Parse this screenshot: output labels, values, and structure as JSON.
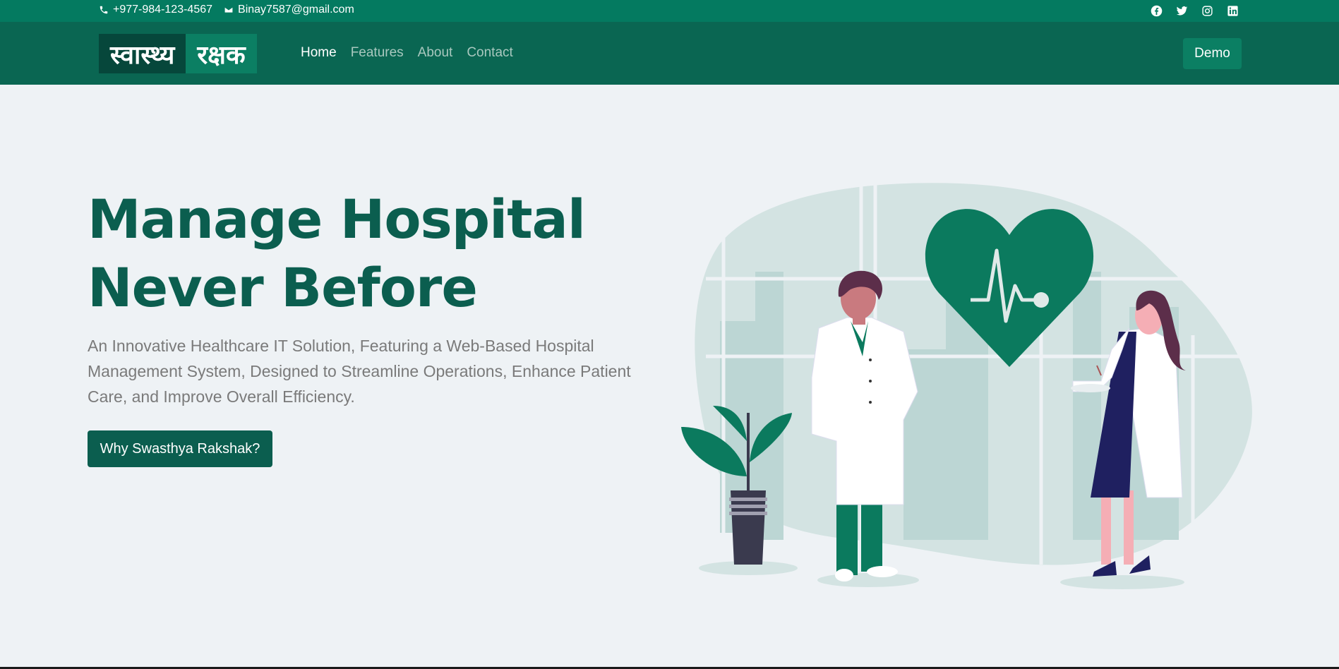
{
  "topbar": {
    "phone": "+977-984-123-4567",
    "email": "Binay7587@gmail.com",
    "social": [
      {
        "name": "facebook-icon"
      },
      {
        "name": "twitter-icon"
      },
      {
        "name": "instagram-icon"
      },
      {
        "name": "linkedin-icon"
      }
    ]
  },
  "navbar": {
    "logo_part1": "स्वास्थ्य",
    "logo_part2": "रक्षक",
    "links": [
      "Home",
      "Features",
      "About",
      "Contact"
    ],
    "active": "Home",
    "demo_label": "Demo"
  },
  "hero": {
    "title_line1": "Manage Hospital",
    "title_line2": "Never Before",
    "description": "An Innovative Healthcare IT Solution, Featuring a Web-Based Hospital Management System, Designed to Streamline Operations, Enhance Patient Care, and Improve Overall Efficiency.",
    "cta_label": "Why Swasthya Rakshak?"
  },
  "colors": {
    "topbar": "#047a60",
    "navbar": "#0a6652",
    "brand_dark": "#0b5e4f",
    "accent": "#0b7f63",
    "background": "#eef2f5"
  }
}
